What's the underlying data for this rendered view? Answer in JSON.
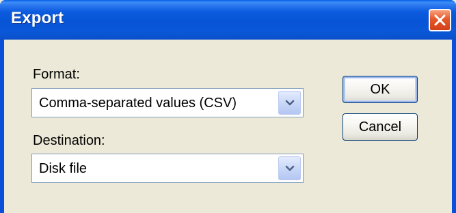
{
  "window": {
    "title": "Export",
    "close_icon": "close-icon"
  },
  "form": {
    "format_label": "Format:",
    "format_value": "Comma-separated values (CSV)",
    "destination_label": "Destination:",
    "destination_value": "Disk file",
    "dropdown_icon": "chevron-down-icon"
  },
  "buttons": {
    "ok_label": "OK",
    "cancel_label": "Cancel"
  },
  "colors": {
    "titlebar": "#0a58d8",
    "close_button": "#e5582b",
    "dialog_background": "#ece9d8",
    "field_border": "#7f9db9"
  }
}
